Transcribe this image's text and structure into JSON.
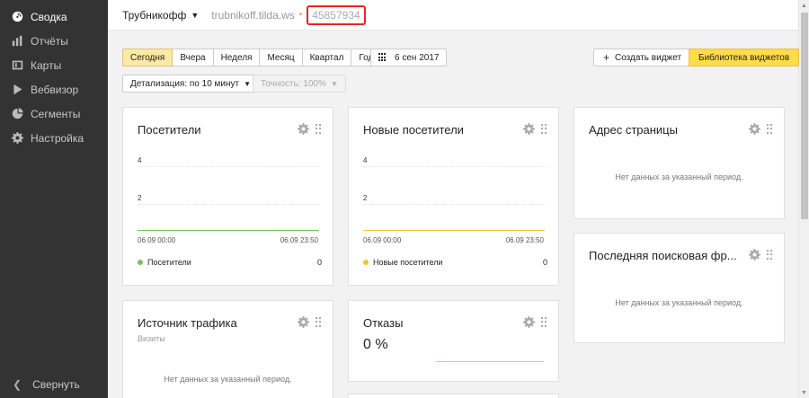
{
  "sidebar": {
    "items": [
      {
        "label": "Сводка",
        "icon": "gauge-icon",
        "active": true
      },
      {
        "label": "Отчёты",
        "icon": "bar-chart-icon"
      },
      {
        "label": "Карты",
        "icon": "map-icon"
      },
      {
        "label": "Вебвизор",
        "icon": "play-icon"
      },
      {
        "label": "Сегменты",
        "icon": "segments-icon"
      },
      {
        "label": "Настройка",
        "icon": "gear-icon"
      }
    ],
    "collapse_label": "Свернуть"
  },
  "topbar": {
    "site_name": "Трубникофф",
    "site_url": "trubnikoff.tilda.ws",
    "counter_id": "45857934"
  },
  "periods": [
    "Сегодня",
    "Вчера",
    "Неделя",
    "Месяц",
    "Квартал",
    "Год"
  ],
  "active_period": "Сегодня",
  "date_label": "6 сен 2017",
  "create_widget_label": "Создать виджет",
  "library_label": "Библиотека виджетов",
  "detail_label": "Детализация: по 10 минут",
  "accuracy_label": "Точность: 100%",
  "no_data_text": "Нет данных за указанный период.",
  "widgets": {
    "visitors": {
      "title": "Посетители",
      "y_ticks": [
        "4",
        "2"
      ],
      "x_start": "06.09 00:00",
      "x_end": "06.09 23:50",
      "legend_label": "Посетители",
      "legend_value": "0",
      "color": "#7cc05a"
    },
    "new_visitors": {
      "title": "Новые посетители",
      "y_ticks": [
        "4",
        "2"
      ],
      "x_start": "06.09 00:00",
      "x_end": "06.09 23:50",
      "legend_label": "Новые посетители",
      "legend_value": "0",
      "color": "#f2c230"
    },
    "page_address": {
      "title": "Адрес страницы"
    },
    "last_search": {
      "title": "Последняя поисковая фр..."
    },
    "traffic_source": {
      "title": "Источник трафика",
      "subtitle": "Визиты"
    },
    "bounces": {
      "title": "Отказы",
      "value": "0 %",
      "color": "#9ad8ec"
    }
  }
}
